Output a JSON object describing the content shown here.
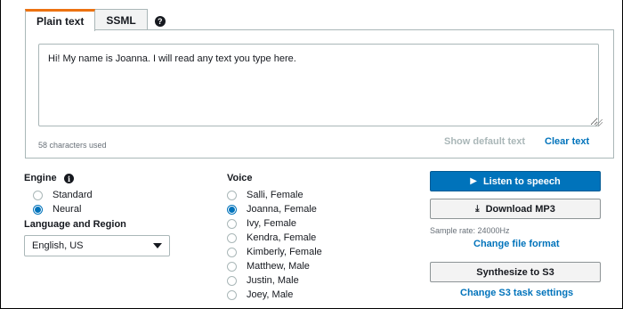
{
  "tabs": [
    {
      "label": "Plain text",
      "active": true
    },
    {
      "label": "SSML",
      "active": false
    }
  ],
  "help_icon": "?",
  "editor": {
    "text": "Hi! My name is Joanna. I will read any text you type here.",
    "char_count": "58 characters used",
    "show_default": "Show default text",
    "clear_text": "Clear text"
  },
  "engine": {
    "label": "Engine",
    "info_icon": "i",
    "options": [
      {
        "label": "Standard",
        "checked": false
      },
      {
        "label": "Neural",
        "checked": true
      }
    ]
  },
  "language": {
    "label": "Language and Region",
    "selected": "English, US"
  },
  "voice": {
    "label": "Voice",
    "options": [
      {
        "label": "Salli, Female",
        "checked": false
      },
      {
        "label": "Joanna, Female",
        "checked": true
      },
      {
        "label": "Ivy, Female",
        "checked": false
      },
      {
        "label": "Kendra, Female",
        "checked": false
      },
      {
        "label": "Kimberly, Female",
        "checked": false
      },
      {
        "label": "Matthew, Male",
        "checked": false
      },
      {
        "label": "Justin, Male",
        "checked": false
      },
      {
        "label": "Joey, Male",
        "checked": false
      }
    ]
  },
  "actions": {
    "listen": "Listen to speech",
    "download": "Download MP3",
    "sample_rate": "Sample rate: 24000Hz",
    "change_format": "Change file format",
    "synthesize": "Synthesize to S3",
    "change_s3": "Change S3 task settings"
  },
  "colors": {
    "accent_tab": "#ec7211",
    "primary": "#0073bb",
    "link": "#0073bb"
  }
}
